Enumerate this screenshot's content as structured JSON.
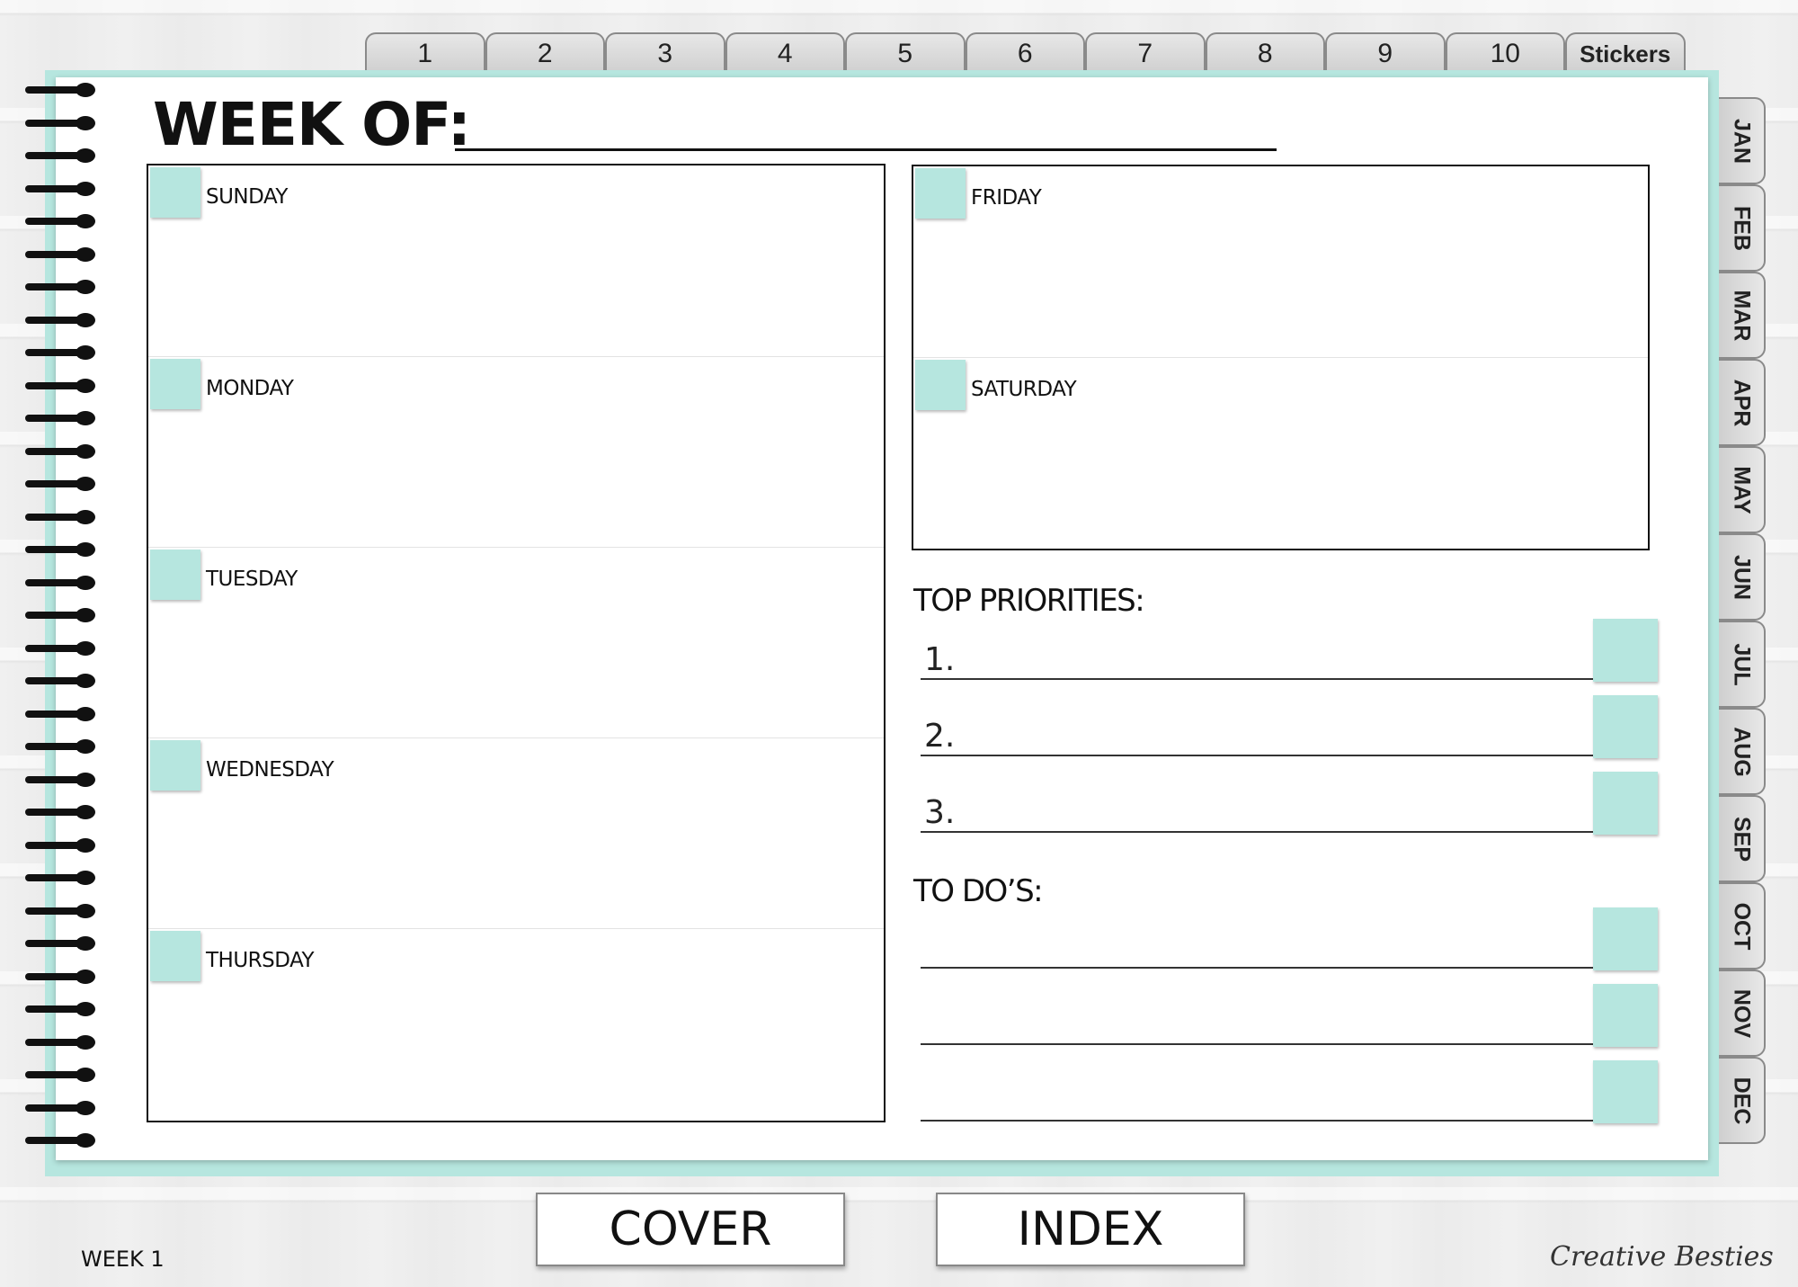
{
  "top_tabs": [
    "1",
    "2",
    "3",
    "4",
    "5",
    "6",
    "7",
    "8",
    "9",
    "10",
    "Stickers"
  ],
  "month_tabs": [
    "JAN",
    "FEB",
    "MAR",
    "APR",
    "MAY",
    "JUN",
    "JUL",
    "AUG",
    "SEP",
    "OCT",
    "NOV",
    "DEC"
  ],
  "header": {
    "week_of_label": "WEEK OF:"
  },
  "days_left": [
    "SUNDAY",
    "MONDAY",
    "TUESDAY",
    "WEDNESDAY",
    "THURSDAY"
  ],
  "days_right": [
    "FRIDAY",
    "SATURDAY"
  ],
  "priorities": {
    "title": "TOP PRIORITIES:",
    "items": [
      "1.",
      "2.",
      "3."
    ]
  },
  "todos": {
    "title": "TO DO’S:"
  },
  "nav": {
    "cover": "COVER",
    "index": "INDEX"
  },
  "footer": {
    "week": "WEEK 1",
    "brand": "Creative Besties"
  },
  "colors": {
    "accent": "#b6e6df",
    "ink": "#111111"
  }
}
